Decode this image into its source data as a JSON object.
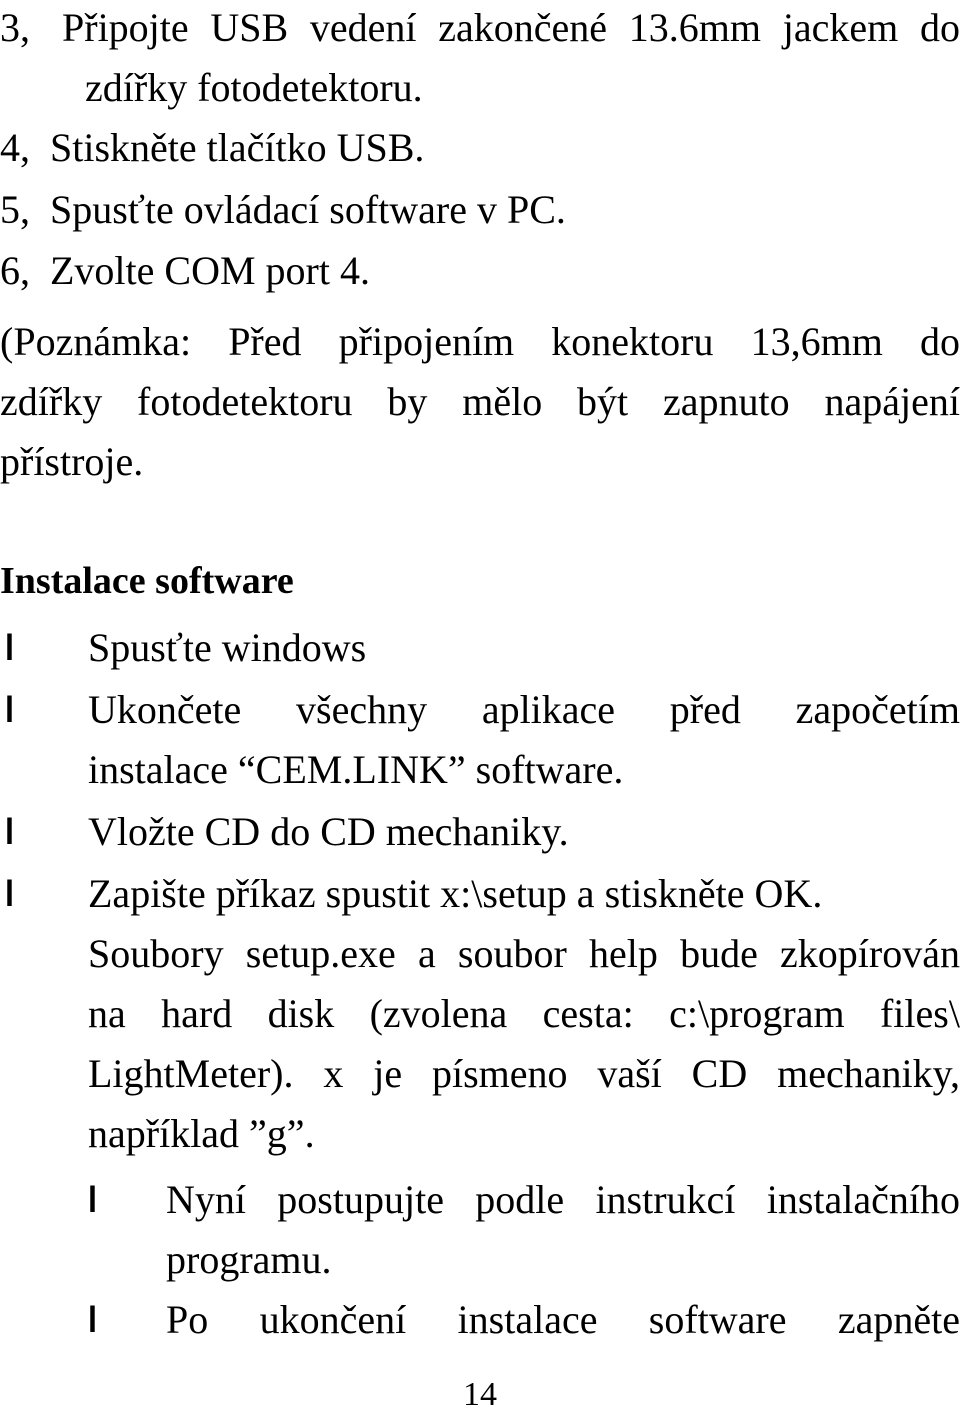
{
  "document": {
    "language": "cs",
    "page_number": "14",
    "bullet_glyph": "l",
    "text_color": "#000000",
    "background_color": "#ffffff"
  },
  "numbered_steps": [
    {
      "marker": "3,",
      "line1_words": [
        "Připojte",
        "USB",
        "vedení",
        "zakončené",
        "13.6mm",
        "jackem",
        "do"
      ],
      "line2": "zdířky fotodetektoru."
    },
    {
      "marker": "4,",
      "text": "Stiskněte tlačítko USB."
    },
    {
      "marker": "5,",
      "text": "Spusťte ovládací software v PC."
    },
    {
      "marker": "6,",
      "text": "Zvolte COM port 4."
    }
  ],
  "note": {
    "line1_words": [
      "(Poznámka:",
      "Před",
      "připojením",
      "konektoru",
      "13,6mm",
      "do"
    ],
    "line2_words": [
      "zdířky",
      "fotodetektoru",
      "by",
      "mělo",
      "být",
      "zapnuto",
      "napájení"
    ],
    "line3": "přístroje."
  },
  "section": {
    "heading": "Instalace software"
  },
  "bullets": [
    {
      "id": "spustte-windows",
      "lines": [
        {
          "kind": "plain",
          "text": "Spusťte windows"
        }
      ]
    },
    {
      "id": "ukoncete-aplikace",
      "lines": [
        {
          "kind": "justified",
          "words": [
            "Ukončete",
            "všechny",
            "aplikace",
            "před",
            "započetím"
          ]
        },
        {
          "kind": "plain",
          "text": "instalace “CEM.LINK” software."
        }
      ]
    },
    {
      "id": "vlozte-cd",
      "lines": [
        {
          "kind": "plain",
          "text": "Vložte CD do CD mechaniky."
        }
      ]
    },
    {
      "id": "zapiste-prikaz",
      "lines": [
        {
          "kind": "plain",
          "text": "Zapište příkaz spustit x:\\setup a stiskněte OK."
        },
        {
          "kind": "justified",
          "words": [
            "Soubory",
            "setup.exe",
            "a",
            "soubor",
            "help",
            "bude",
            "zkopírován"
          ]
        },
        {
          "kind": "justified",
          "words": [
            "na",
            "hard",
            "disk",
            "(zvolena",
            "cesta:",
            "c:\\program",
            "files\\"
          ]
        },
        {
          "kind": "justified",
          "words": [
            "LightMeter).",
            "x",
            "je",
            "písmeno",
            "vaší",
            "CD",
            "mechaniky,"
          ]
        },
        {
          "kind": "plain",
          "text": "například ”g”."
        }
      ]
    },
    {
      "id": "nyni-postupujte",
      "lines": [
        {
          "kind": "justified",
          "words": [
            "Nyní",
            "postupujte",
            "podle",
            "instrukcí",
            "instalačního"
          ]
        },
        {
          "kind": "plain",
          "text": "programu."
        }
      ]
    },
    {
      "id": "po-ukonceni",
      "lines": [
        {
          "kind": "justified",
          "words": [
            "Po",
            "ukončení",
            "instalace",
            "software",
            "zapněte"
          ]
        }
      ]
    }
  ]
}
